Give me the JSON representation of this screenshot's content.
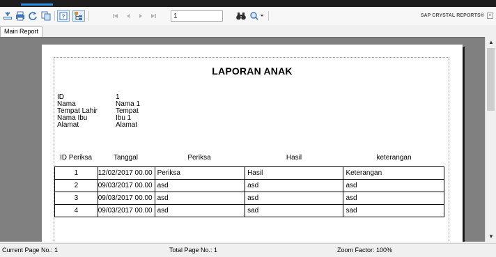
{
  "toolbar": {
    "page_number": "1",
    "brand": "SAP CRYSTAL REPORTS",
    "brand_mark": "®"
  },
  "tabs": [
    {
      "label": "Main Report"
    }
  ],
  "report": {
    "title": "LAPORAN ANAK",
    "fields": [
      {
        "label": "ID",
        "value": "1"
      },
      {
        "label": "Nama",
        "value": "Nama 1"
      },
      {
        "label": "Tempat Lahir",
        "value": "Tempat"
      },
      {
        "label": "Nama Ibu",
        "value": "Ibu 1"
      },
      {
        "label": "Alamat",
        "value": "Alamat"
      }
    ],
    "columns": [
      "ID Periksa",
      "Tanggal",
      "Periksa",
      "Hasil",
      "keterangan"
    ],
    "rows": [
      [
        "1",
        "12/02/2017  00.00",
        "Periksa",
        "Hasil",
        "Keterangan"
      ],
      [
        "2",
        "09/03/2017  00.00",
        "asd",
        "asd",
        "asd"
      ],
      [
        "3",
        "09/03/2017  00.00",
        "asd",
        "asd",
        "asd"
      ],
      [
        "4",
        "09/03/2017  00.00",
        "asd",
        "sad",
        "sad"
      ]
    ]
  },
  "status": {
    "current_page": "Current Page No.: 1",
    "total_page": "Total Page No.: 1",
    "zoom": "Zoom Factor: 100%"
  },
  "icons": {
    "export": "export-icon",
    "print": "print-icon",
    "refresh": "refresh-icon",
    "copy": "copy-icon",
    "toggle_parameters": "parameters-icon",
    "group_tree": "group-tree-icon",
    "first_page": "first-page-icon",
    "prev_page": "previous-page-icon",
    "next_page": "next-page-icon",
    "last_page": "last-page-icon",
    "find": "binoculars-icon",
    "zoom": "zoom-icon"
  }
}
